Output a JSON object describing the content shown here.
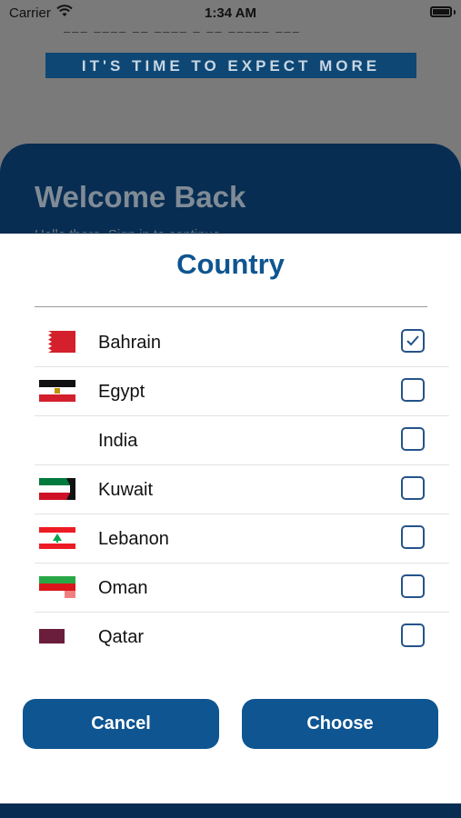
{
  "status_bar": {
    "carrier": "Carrier",
    "time": "1:34 AM"
  },
  "background": {
    "tagline": "IT'S TIME TO EXPECT MORE",
    "welcome_title": "Welcome Back",
    "welcome_subtitle": "Hello there, Sign in to continue"
  },
  "picker": {
    "title": "Country",
    "countries": [
      {
        "name": "Bahrain",
        "flag_icon": "bahrain-flag-icon",
        "checked": true
      },
      {
        "name": "Egypt",
        "flag_icon": "egypt-flag-icon",
        "checked": false
      },
      {
        "name": "India",
        "flag_icon": "",
        "checked": false
      },
      {
        "name": "Kuwait",
        "flag_icon": "kuwait-flag-icon",
        "checked": false
      },
      {
        "name": "Lebanon",
        "flag_icon": "lebanon-flag-icon",
        "checked": false
      },
      {
        "name": "Oman",
        "flag_icon": "oman-flag-icon",
        "checked": false
      },
      {
        "name": "Qatar",
        "flag_icon": "qatar-flag-icon",
        "checked": false
      }
    ],
    "cancel_label": "Cancel",
    "choose_label": "Choose"
  },
  "colors": {
    "primary": "#0e5591",
    "navy": "#082d52",
    "checkbox_border": "#25538a"
  }
}
